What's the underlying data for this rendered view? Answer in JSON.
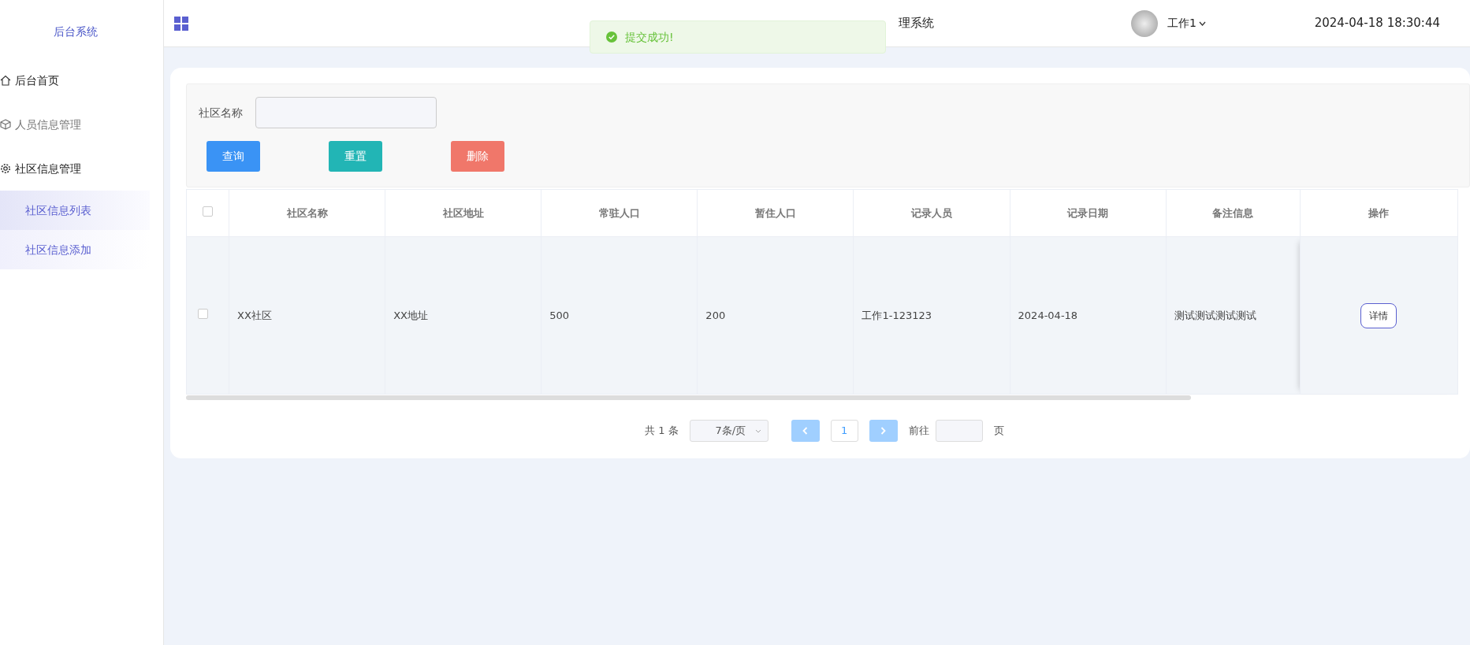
{
  "sidebar": {
    "logo": "后台系统",
    "items": [
      {
        "label": "后台首页",
        "kind": "home",
        "muted": false
      },
      {
        "label": "人员信息管理",
        "kind": "cube",
        "muted": true
      },
      {
        "label": "社区信息管理",
        "kind": "gear",
        "muted": false,
        "expanded": true,
        "children": [
          {
            "label": "社区信息列表",
            "selected": true
          },
          {
            "label": "社区信息添加",
            "selected": false
          }
        ]
      }
    ]
  },
  "header": {
    "title": "理系统",
    "user": "工作1",
    "datetime": "2024-04-18 18:30:44"
  },
  "toast": {
    "message": "提交成功!"
  },
  "search": {
    "label": "社区名称",
    "buttons": [
      {
        "label": "查询",
        "kind": "primary"
      },
      {
        "label": "重置",
        "kind": "reset"
      },
      {
        "label": "删除",
        "kind": "danger"
      }
    ]
  },
  "table": {
    "select_all_checked": false,
    "columns": [
      "社区名称",
      "社区地址",
      "常驻人口",
      "暂住人口",
      "记录人员",
      "记录日期",
      "备注信息",
      "操作"
    ],
    "rows": [
      {
        "checked": false,
        "cells": [
          "XX社区",
          "XX地址",
          "500",
          "200",
          "工作1-123123",
          "2024-04-18",
          "测试测试测试测试"
        ],
        "action": "详情"
      }
    ]
  },
  "pagination": {
    "total": "共 1 条",
    "page_size": "7条/页",
    "pages": [
      {
        "label": "1",
        "selected": true
      }
    ],
    "goto_label": "前往",
    "goto_suffix": "页"
  }
}
